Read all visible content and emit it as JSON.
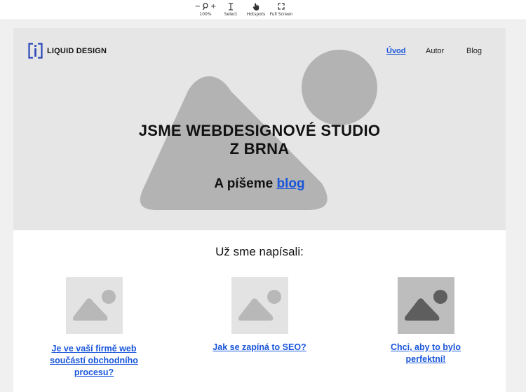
{
  "toolbar": {
    "zoom_label": "100%",
    "zoom_out": "−",
    "zoom_in": "+",
    "select_label": "Select",
    "hotspots_label": "Hotspots",
    "fullscreen_label": "Full Screen"
  },
  "header": {
    "logo_text": "LIQUID DESIGN",
    "nav": [
      "Úvod",
      "Autor",
      "Blog"
    ],
    "active_nav": "Úvod"
  },
  "hero": {
    "title_line1": "JSME WEBDESIGNOVÉ STUDIO",
    "title_line2": "Z BRNA",
    "subtitle_prefix": "A píšeme",
    "subtitle_link": "blog"
  },
  "posts": {
    "section_title": "Už sme napísali:",
    "items": [
      {
        "title_line1": " Je ve vaší firmě web",
        "title_line2": "součástí obchodního",
        "title_line3": "procesu?"
      },
      {
        "title_line1": "Jak se zapíná to SEO?"
      },
      {
        "title_line1": "Chci, aby to bylo",
        "title_line2": "perfektní!"
      }
    ]
  },
  "colors": {
    "link": "#1a56db",
    "hero_bg": "#e6e6e6",
    "placeholder_shape": "#b3b3b3"
  }
}
